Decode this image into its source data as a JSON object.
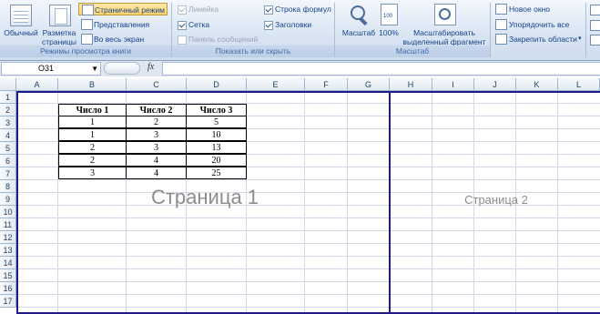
{
  "ribbon": {
    "group_views": {
      "label": "Режимы просмотра книги",
      "normal": "Обычный",
      "page_layout_1": "Разметка",
      "page_layout_2": "страницы",
      "page_break": "Страничный режим",
      "custom_views": "Представления",
      "full_screen": "Во весь экран"
    },
    "group_show": {
      "label": "Показать или скрыть",
      "ruler": "Линейка",
      "gridlines": "Сетка",
      "message_bar": "Панель сообщений",
      "formula_bar": "Строка формул",
      "headings": "Заголовки",
      "ruler_checked": true,
      "gridlines_checked": true,
      "message_bar_checked": false,
      "formula_bar_checked": true,
      "headings_checked": true
    },
    "group_zoom": {
      "label": "Масштаб",
      "zoom": "Масштаб",
      "hundred": "100%",
      "selection_1": "Масштабировать",
      "selection_2": "выделенный фрагмент"
    },
    "group_window": {
      "new_window": "Новое окно",
      "arrange_all": "Упорядочить все",
      "freeze_panes": "Закрепить области"
    }
  },
  "formula_bar": {
    "name_box": "O31",
    "fx": "fx",
    "content": ""
  },
  "columns": [
    "A",
    "B",
    "C",
    "D",
    "E",
    "F",
    "G",
    "H",
    "I",
    "J",
    "K",
    "L"
  ],
  "rows": [
    "1",
    "2",
    "3",
    "4",
    "5",
    "6",
    "7",
    "8",
    "9",
    "10",
    "11",
    "12",
    "13",
    "14",
    "15",
    "16",
    "17"
  ],
  "table": {
    "headers": [
      "Число 1",
      "Число 2",
      "Число 3"
    ],
    "rows": [
      [
        "1",
        "2",
        "5"
      ],
      [
        "1",
        "3",
        "10"
      ],
      [
        "2",
        "3",
        "13"
      ],
      [
        "2",
        "4",
        "20"
      ],
      [
        "3",
        "4",
        "25"
      ]
    ]
  },
  "pages": {
    "page1": "Страница 1",
    "page2": "Страница 2"
  }
}
